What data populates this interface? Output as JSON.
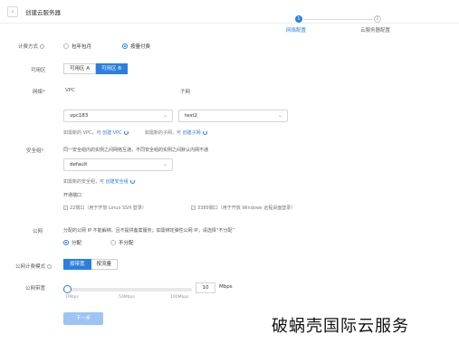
{
  "header": {
    "back_glyph": "‹",
    "title": "创建云服务器"
  },
  "steps": [
    {
      "index": "1",
      "label": "网络配置",
      "active": true
    },
    {
      "index": "2",
      "label": "云服务器配置",
      "active": false
    }
  ],
  "billing": {
    "label": "计费方式",
    "options": [
      "包年包月",
      "按量付费"
    ],
    "selected": "按量付费"
  },
  "zone": {
    "label": "可用区",
    "options": [
      "可用区 A",
      "可用区 B"
    ],
    "selected": "可用区 B"
  },
  "network": {
    "label": "网络",
    "vpc_header": "VPC",
    "subnet_header": "子网",
    "vpc_value": "vpc183",
    "subnet_value": "test2",
    "vpc_hint_prefix": "如需新的 VPC，可",
    "vpc_hint_link": "创建 VPC",
    "subnet_hint_prefix": "如需新的子网，可",
    "subnet_hint_link": "创建子网"
  },
  "security_group": {
    "label": "安全组",
    "description": "同一安全组内的实例之间网络互通，不同安全组的实例之间默认内网不通",
    "value": "default",
    "hint_prefix": "如需新的安全组，可",
    "hint_link": "创建安全组",
    "ports_label": "开通端口",
    "ports": [
      {
        "label": "22端口（用于开放 Linux SSH 登录）",
        "checked": true
      },
      {
        "label": "3389端口（用于开放 Windows 远程桌面登录）",
        "checked": true
      }
    ]
  },
  "public_ip": {
    "label": "公网",
    "description": "分配的公网 IP 不能解绑，且不提供备案服务；如需绑定弹性公网 IP，请选择“不分配”",
    "options": [
      "分配",
      "不分配"
    ],
    "selected": "分配"
  },
  "bandwidth_billing": {
    "label": "公网计费模式",
    "options": [
      "按带宽",
      "按流量"
    ],
    "selected": "按带宽"
  },
  "bandwidth": {
    "label": "公网带宽",
    "value": "10",
    "unit": "Mbps",
    "level_fraction": 0.0,
    "ticks": [
      "1Mbps",
      "50Mbps",
      "100Mbps"
    ]
  },
  "footer": {
    "next_label": "下一步"
  },
  "watermark": "破蜗壳国际云服务",
  "colors": {
    "accent": "#2b7fe0",
    "disabled_button": "#9dc4f2"
  }
}
